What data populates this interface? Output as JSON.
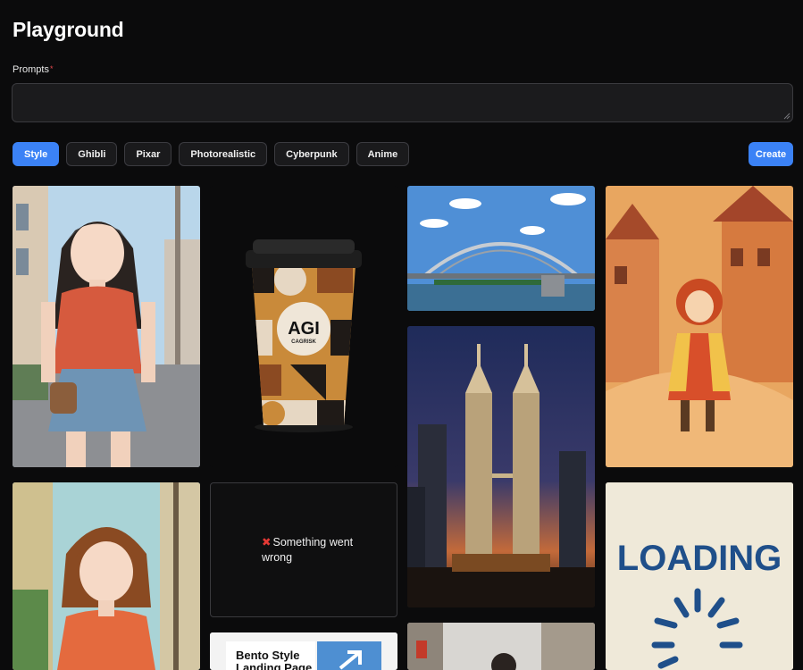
{
  "header": {
    "title": "Playground"
  },
  "prompt": {
    "label": "Prompts",
    "required_mark": "*",
    "value": "",
    "placeholder": ""
  },
  "styles": {
    "items": [
      {
        "id": "style",
        "label": "Style",
        "active": true
      },
      {
        "id": "ghibli",
        "label": "Ghibli",
        "active": false
      },
      {
        "id": "pixar",
        "label": "Pixar",
        "active": false
      },
      {
        "id": "photorealistic",
        "label": "Photorealistic",
        "active": false
      },
      {
        "id": "cyberpunk",
        "label": "Cyberpunk",
        "active": false
      },
      {
        "id": "anime",
        "label": "Anime",
        "active": false
      }
    ]
  },
  "actions": {
    "create_label": "Create"
  },
  "gallery": {
    "cup": {
      "brand": "AGI",
      "sub": "CAGRISK"
    },
    "error": {
      "icon": "x-mark-icon",
      "message": "Something went wrong"
    },
    "bento": {
      "line1": "Bento Style",
      "line2": "Landing Page"
    },
    "loading": {
      "text": "LOADING"
    }
  },
  "colors": {
    "accent": "#3b82f6",
    "background": "#0b0b0c",
    "error": "#e53935"
  }
}
